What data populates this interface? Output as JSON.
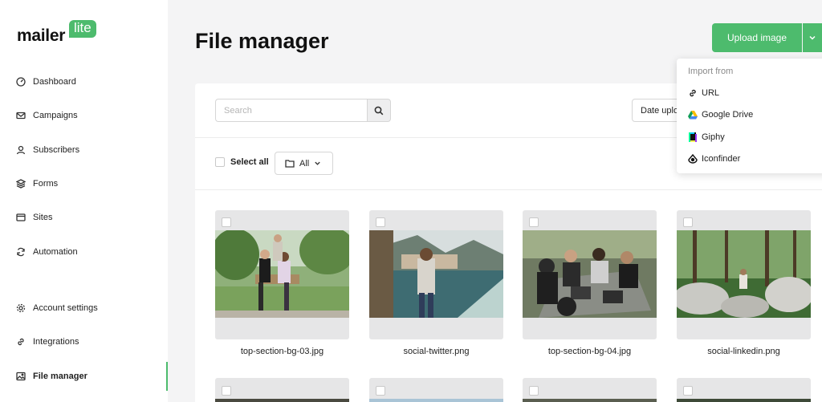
{
  "brand": {
    "name_part1": "mailer",
    "name_part2": "lite",
    "accent": "#4dbb6d"
  },
  "sidebar": {
    "items": [
      {
        "label": "Dashboard",
        "icon": "dashboard-icon"
      },
      {
        "label": "Campaigns",
        "icon": "mail-icon"
      },
      {
        "label": "Subscribers",
        "icon": "user-icon"
      },
      {
        "label": "Forms",
        "icon": "layers-icon"
      },
      {
        "label": "Sites",
        "icon": "browser-icon"
      },
      {
        "label": "Automation",
        "icon": "refresh-icon"
      },
      {
        "label": "Account settings",
        "icon": "gear-icon"
      },
      {
        "label": "Integrations",
        "icon": "link-icon"
      },
      {
        "label": "File manager",
        "icon": "image-icon",
        "active": true
      }
    ]
  },
  "main": {
    "title": "File manager",
    "upload_button": "Upload image",
    "search_placeholder": "Search",
    "sort_label": "Date uploaded",
    "select_all": "Select all",
    "folder_filter": "All"
  },
  "import_menu": {
    "heading": "Import from",
    "items": [
      {
        "label": "URL",
        "icon": "link-icon"
      },
      {
        "label": "Google Drive",
        "icon": "google-drive-icon"
      },
      {
        "label": "Giphy",
        "icon": "giphy-icon"
      },
      {
        "label": "Iconfinder",
        "icon": "iconfinder-icon"
      }
    ]
  },
  "files": [
    {
      "name": "top-section-bg-03.jpg"
    },
    {
      "name": "social-twitter.png"
    },
    {
      "name": "top-section-bg-04.jpg"
    },
    {
      "name": "social-linkedin.png"
    }
  ]
}
